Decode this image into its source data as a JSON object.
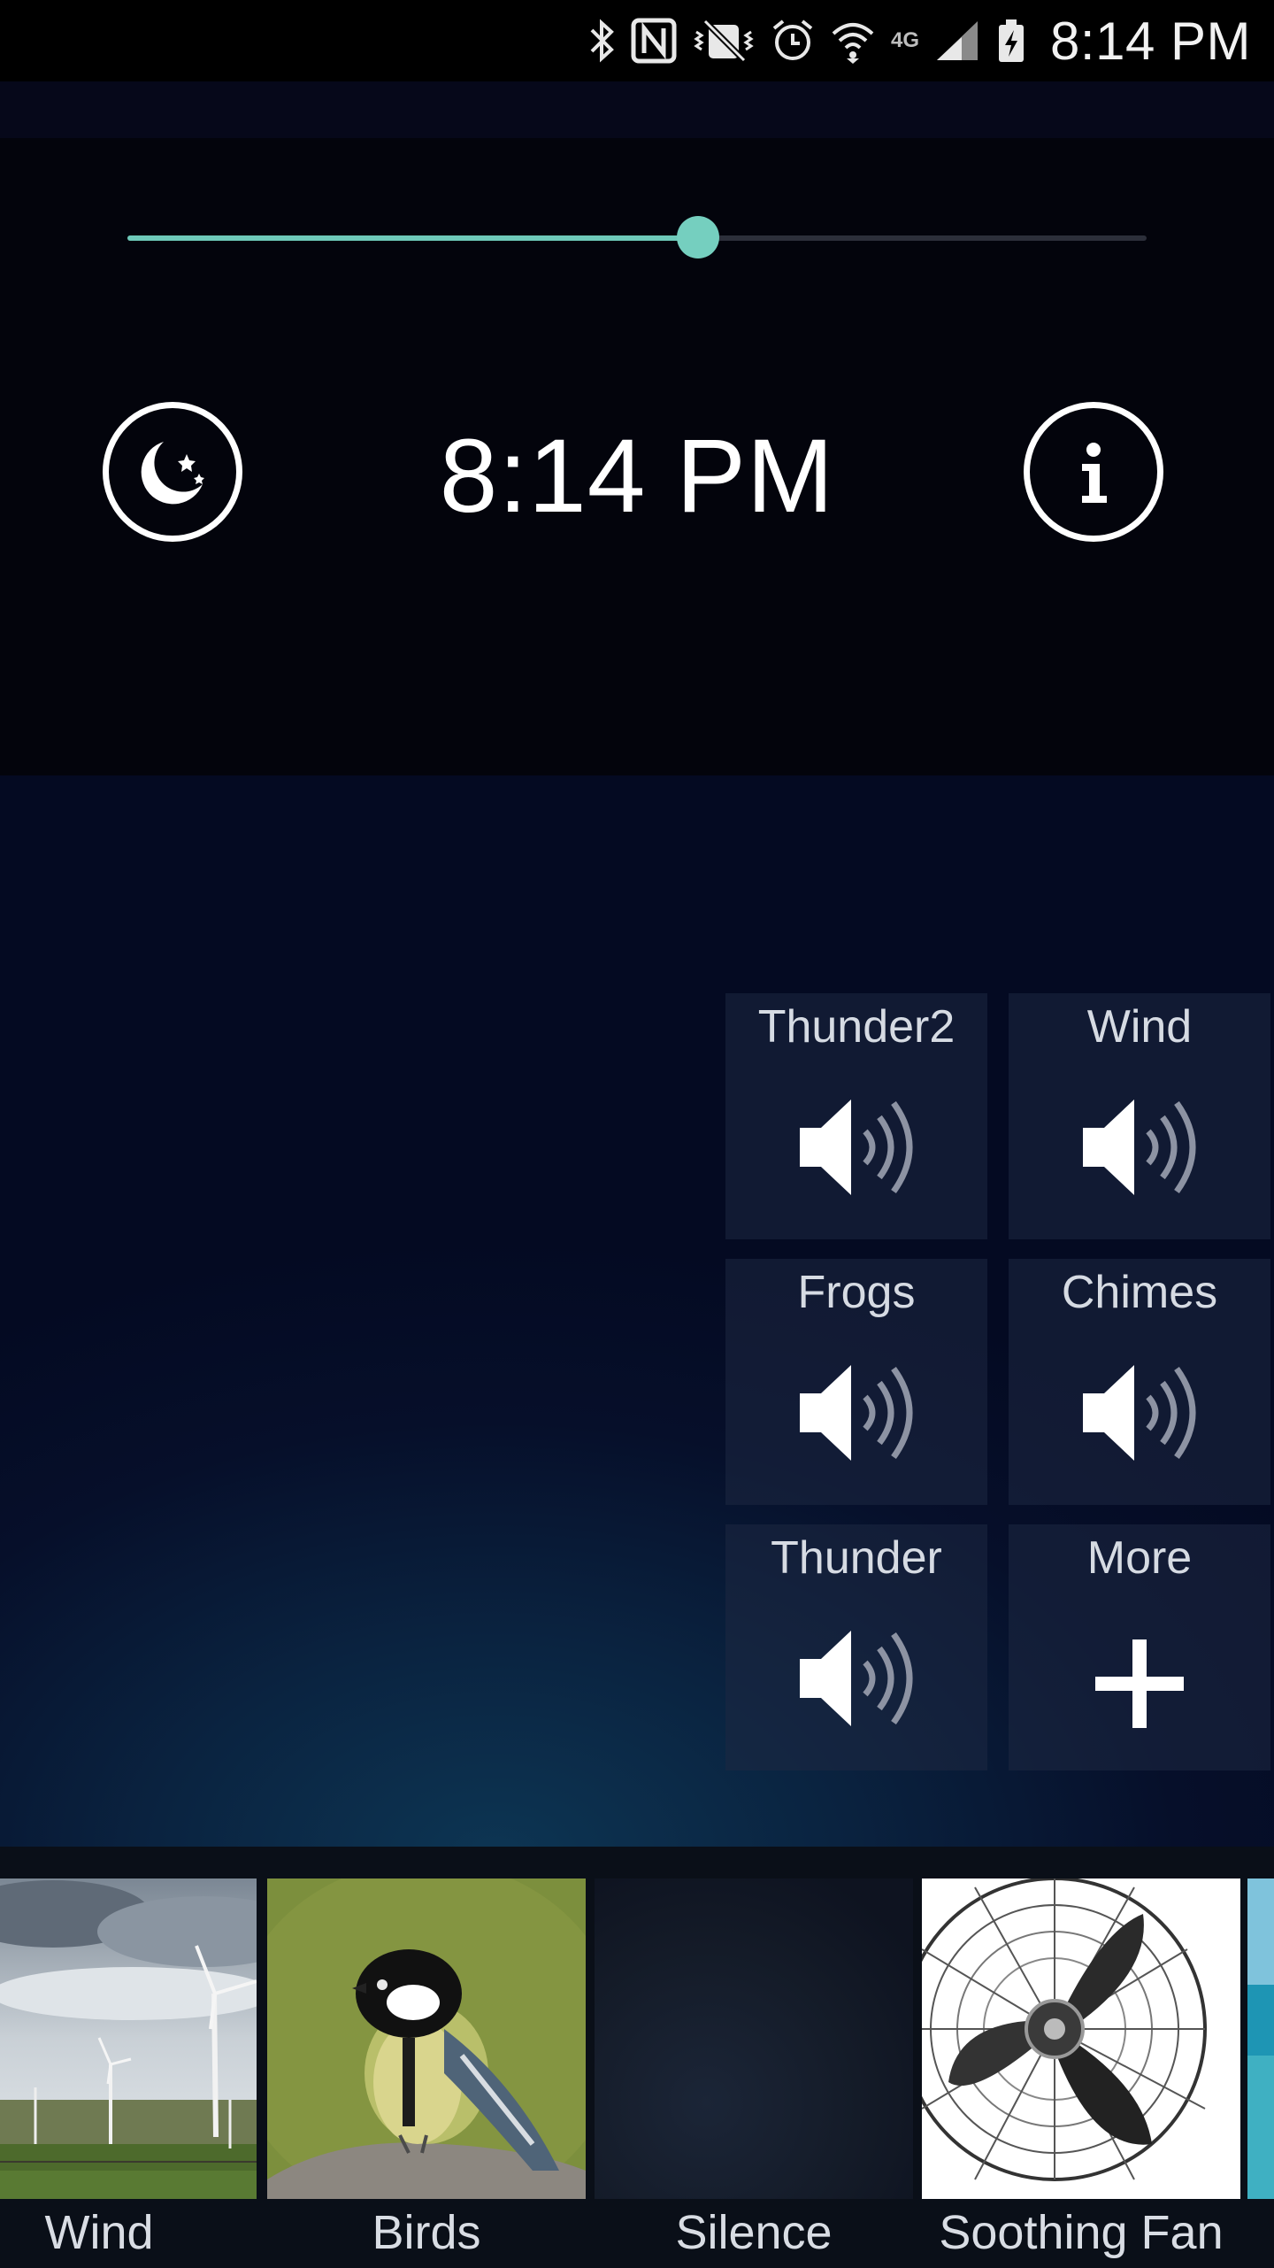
{
  "status_bar": {
    "time": "8:14 PM",
    "icons": [
      "bluetooth-icon",
      "nfc-icon",
      "vibrate-mute-icon",
      "alarm-icon",
      "wifi-icon",
      "lte-icon",
      "signal-icon",
      "battery-charging-icon"
    ],
    "network_label": "4G"
  },
  "header": {
    "volume_level": 0.56,
    "clock": "8:14 PM",
    "left_button_icon": "moon-stars-icon",
    "right_button_icon": "info-icon"
  },
  "sound_tiles": [
    {
      "label": "Thunder2",
      "icon": "speaker-icon"
    },
    {
      "label": "Wind",
      "icon": "speaker-icon"
    },
    {
      "label": "Frogs",
      "icon": "speaker-icon"
    },
    {
      "label": "Chimes",
      "icon": "speaker-icon"
    },
    {
      "label": "Thunder",
      "icon": "speaker-icon"
    },
    {
      "label": "More",
      "icon": "plus-icon"
    }
  ],
  "presets": [
    {
      "label": "Wind",
      "image": "wind-turbines-image"
    },
    {
      "label": "Birds",
      "image": "bird-image"
    },
    {
      "label": "Silence",
      "image": "dark-blur-image"
    },
    {
      "label": "Soothing Fan",
      "image": "fan-image"
    },
    {
      "label": "",
      "image": "ocean-image"
    }
  ],
  "colors": {
    "accent": "#6ec9b9",
    "background": "#03040b"
  }
}
